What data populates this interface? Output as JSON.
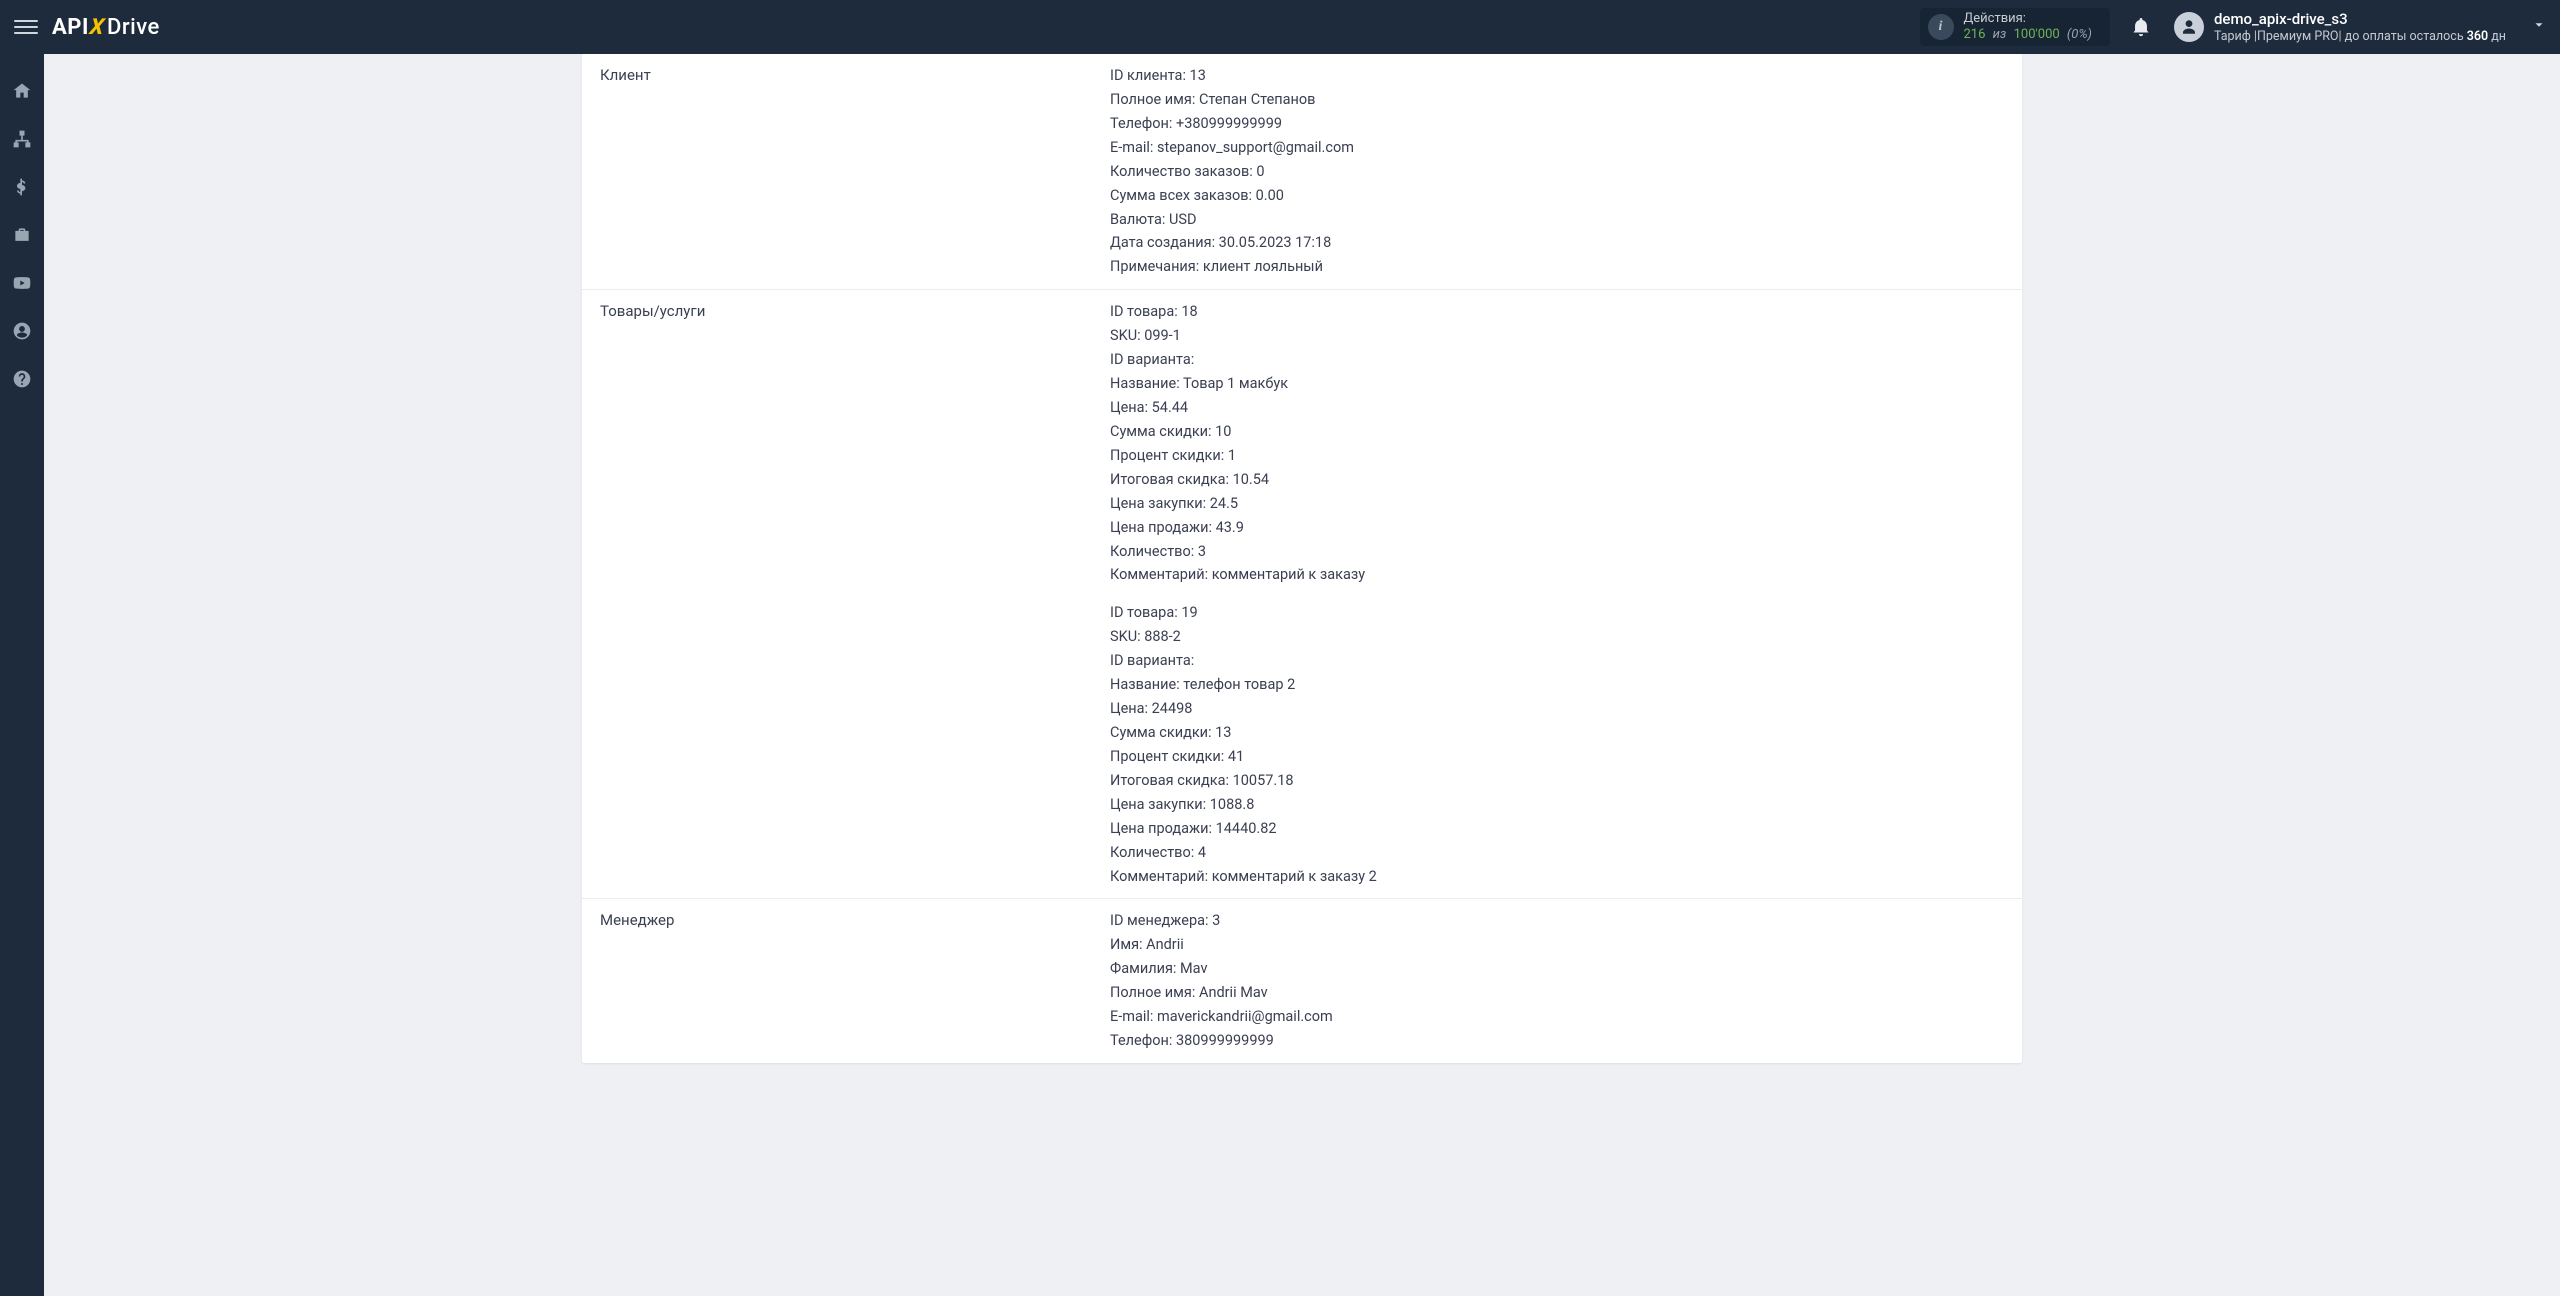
{
  "header": {
    "logo_a": "API",
    "logo_x": "X",
    "logo_b": "Drive",
    "actions_label": "Действия:",
    "actions_current": "216",
    "actions_sep": "из",
    "actions_max": "100'000",
    "actions_pct": "(0%)",
    "username": "demo_apix-drive_s3",
    "plan_prefix": "Тариф |",
    "plan_name": "Премиум PRO",
    "plan_mid": "| до оплаты осталось ",
    "plan_days": "360",
    "plan_suffix": " дн"
  },
  "rows": {
    "client": {
      "label": "Клиент",
      "lines": [
        "ID клиента: 13",
        "Полное имя: Степан Степанов",
        "Телефон: +380999999999",
        "E-mail: stepanov_support@gmail.com",
        "Количество заказов: 0",
        "Сумма всех заказов: 0.00",
        "Валюта: USD",
        "Дата создания: 30.05.2023 17:18",
        "Примечания: клиент лояльный"
      ]
    },
    "products": {
      "label": "Товары/услуги",
      "lines1": [
        "ID товара: 18",
        "SKU: 099-1",
        "ID варианта:",
        "Название: Товар 1 макбук",
        "Цена: 54.44",
        "Сумма скидки: 10",
        "Процент скидки: 1",
        "Итоговая скидка: 10.54",
        "Цена закупки: 24.5",
        "Цена продажи: 43.9",
        "Количество: 3",
        "Комментарий: комментарий к заказу"
      ],
      "lines2": [
        "ID товара: 19",
        "SKU: 888-2",
        "ID варианта:",
        "Название: телефон товар 2",
        "Цена: 24498",
        "Сумма скидки: 13",
        "Процент скидки: 41",
        "Итоговая скидка: 10057.18",
        "Цена закупки: 1088.8",
        "Цена продажи: 14440.82",
        "Количество: 4",
        "Комментарий: комментарий к заказу 2"
      ]
    },
    "manager": {
      "label": "Менеджер",
      "lines": [
        "ID менеджера: 3",
        "Имя: Andrii",
        "Фамилия: Mav",
        "Полное имя: Andrii Mav",
        "E-mail: maverickandrii@gmail.com",
        "Телефон: 380999999999"
      ]
    }
  }
}
